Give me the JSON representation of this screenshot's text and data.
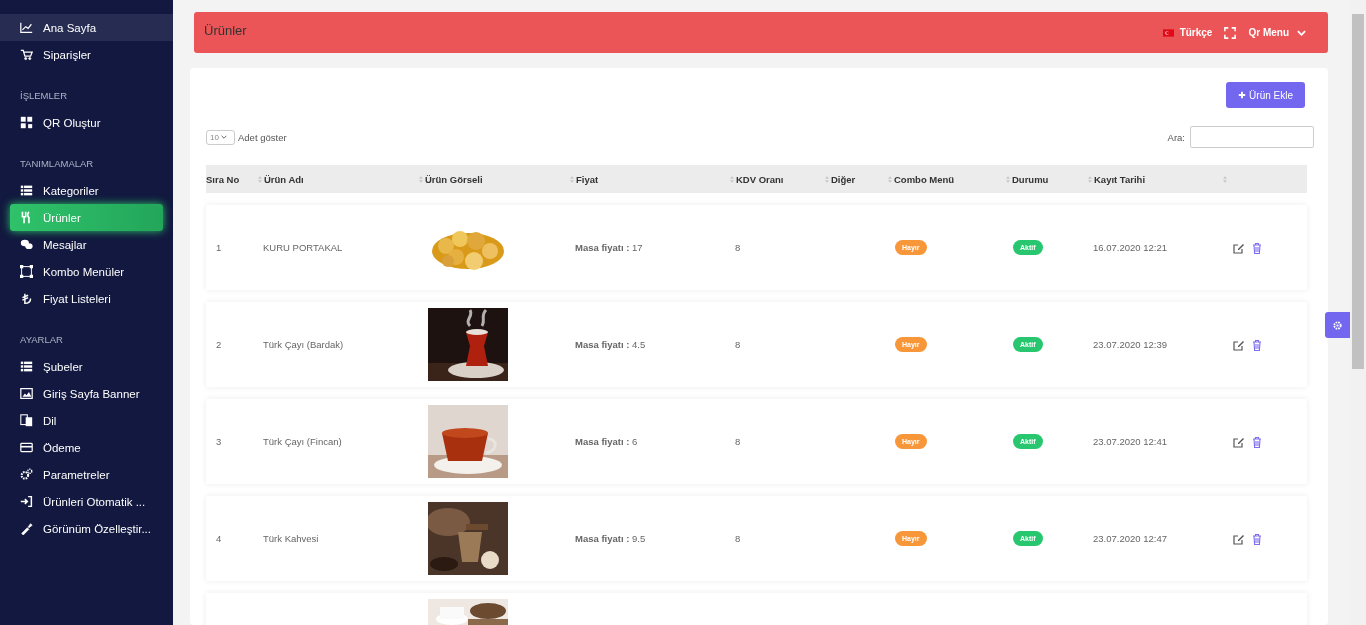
{
  "sidebar": {
    "sections": [
      {
        "items": [
          {
            "label": "Ana Sayfa",
            "selected": false,
            "hovered": true
          },
          {
            "label": "Siparişler",
            "selected": false,
            "hovered": false
          }
        ]
      },
      {
        "heading": "İŞLEMLER",
        "items": [
          {
            "label": "QR Oluştur",
            "selected": false,
            "hovered": false
          }
        ]
      },
      {
        "heading": "TANIMLAMALAR",
        "items": [
          {
            "label": "Kategoriler",
            "selected": false,
            "hovered": false
          },
          {
            "label": "Ürünler",
            "selected": true,
            "hovered": false
          },
          {
            "label": "Mesajlar",
            "selected": false,
            "hovered": false
          },
          {
            "label": "Kombo Menüler",
            "selected": false,
            "hovered": false
          },
          {
            "label": "Fiyat Listeleri",
            "selected": false,
            "hovered": false
          }
        ]
      },
      {
        "heading": "AYARLAR",
        "items": [
          {
            "label": "Şubeler",
            "selected": false,
            "hovered": false
          },
          {
            "label": "Giriş Sayfa Banner",
            "selected": false,
            "hovered": false
          },
          {
            "label": "Dil",
            "selected": false,
            "hovered": false
          },
          {
            "label": "Ödeme",
            "selected": false,
            "hovered": false
          },
          {
            "label": "Parametreler",
            "selected": false,
            "hovered": false
          },
          {
            "label": "Ürünleri Otomatik ...",
            "selected": false,
            "hovered": false
          },
          {
            "label": "Görünüm Özelleştir...",
            "selected": false,
            "hovered": false
          }
        ]
      }
    ]
  },
  "header": {
    "title": "Ürünler",
    "language": "Türkçe",
    "menu": "Qr Menu"
  },
  "toolbar": {
    "add_button": "Ürün Ekle",
    "page_size": "10",
    "page_size_label": "Adet göster",
    "search_label": "Ara:"
  },
  "table": {
    "columns": [
      "Sıra No",
      "Ürün Adı",
      "Ürün Görseli",
      "Fiyat",
      "KDV Oranı",
      "Diğer",
      "Combo Menü",
      "Durumu",
      "Kayıt Tarihi",
      ""
    ],
    "rows": [
      {
        "no": "1",
        "name": "KURU PORTAKAL",
        "image": {
          "kind": "picture"
        },
        "price_label": "Masa fiyatı :",
        "price": "17",
        "vat": "8",
        "combo": "Hayır",
        "status": "Aktif",
        "date": "16.07.2020 12:21"
      },
      {
        "no": "2",
        "name": "Türk Çayı (Bardak)",
        "image": {
          "kind": "picture"
        },
        "price_label": "Masa fiyatı :",
        "price": "4.5",
        "vat": "8",
        "combo": "Hayır",
        "status": "Aktif",
        "date": "23.07.2020 12:39"
      },
      {
        "no": "3",
        "name": "Türk Çayı (Fincan)",
        "image": {
          "kind": "picture"
        },
        "price_label": "Masa fiyatı :",
        "price": "6",
        "vat": "8",
        "combo": "Hayır",
        "status": "Aktif",
        "date": "23.07.2020 12:41"
      },
      {
        "no": "4",
        "name": "Türk Kahvesi",
        "image": {
          "kind": "picture"
        },
        "price_label": "Masa fiyatı :",
        "price": "9.5",
        "vat": "8",
        "combo": "Hayır",
        "status": "Aktif",
        "date": "23.07.2020 12:47"
      },
      {
        "image": {
          "kind": "picture"
        }
      }
    ]
  }
}
